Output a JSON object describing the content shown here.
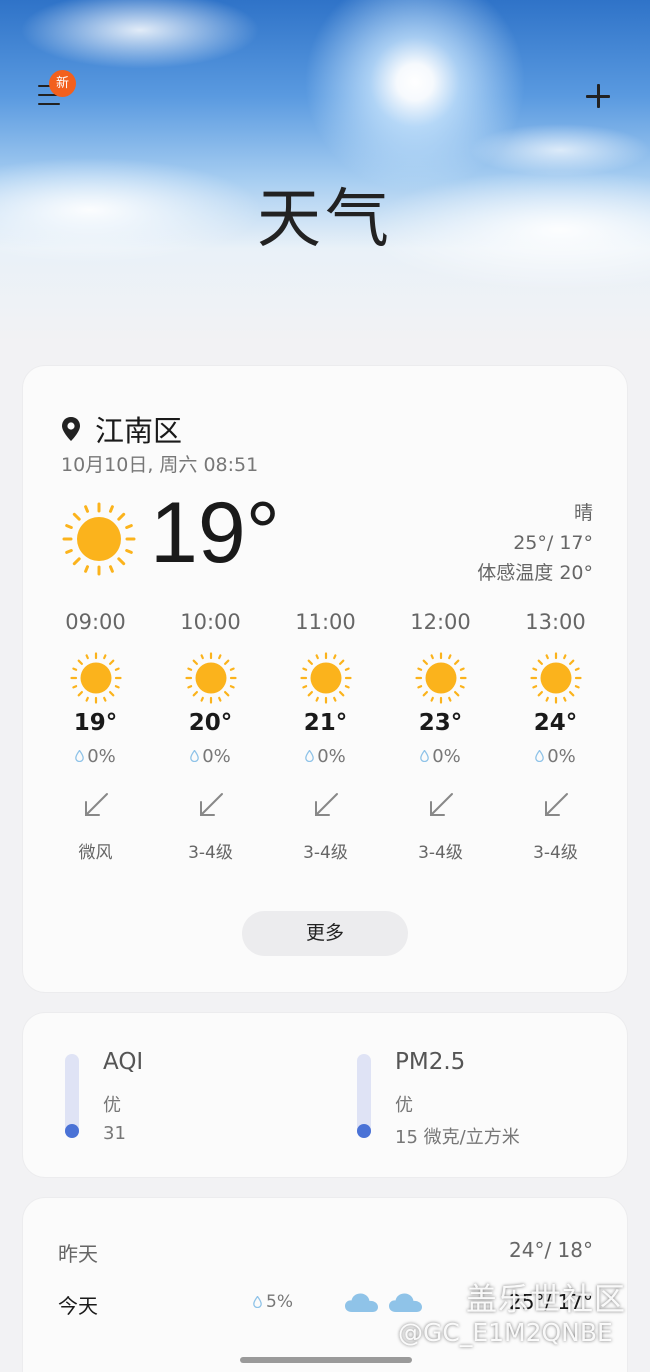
{
  "header": {
    "title": "天气",
    "badge": "新",
    "menu_icon": "menu-icon",
    "add_icon": "plus-icon"
  },
  "current": {
    "location": "江南区",
    "datetime": "10月10日, 周六 08:51",
    "temp": "19°",
    "condition": "晴",
    "high_low": "25°/ 17°",
    "feels_like": "体感温度 20°",
    "icon": "sun-icon"
  },
  "hourly": [
    {
      "time": "09:00",
      "temp": "19°",
      "rain": "0%",
      "wind": "微风"
    },
    {
      "time": "10:00",
      "temp": "20°",
      "rain": "0%",
      "wind": "3-4级"
    },
    {
      "time": "11:00",
      "temp": "21°",
      "rain": "0%",
      "wind": "3-4级"
    },
    {
      "time": "12:00",
      "temp": "23°",
      "rain": "0%",
      "wind": "3-4级"
    },
    {
      "time": "13:00",
      "temp": "24°",
      "rain": "0%",
      "wind": "3-4级"
    }
  ],
  "more_label": "更多",
  "air": {
    "aqi": {
      "label": "AQI",
      "level": "优",
      "value": "31"
    },
    "pm25": {
      "label": "PM2.5",
      "level": "优",
      "value": "15 微克/立方米"
    }
  },
  "daily": [
    {
      "name": "昨天",
      "rain": "",
      "range": "24°/ 18°"
    },
    {
      "name": "今天",
      "rain": "5%",
      "range": "25°/ 17°"
    }
  ],
  "watermark": {
    "line1": "盖乐世社区",
    "line2": "@GC_E1M2QNBE"
  },
  "colors": {
    "accent_badge": "#f2601e",
    "sun": "#fbb31c",
    "gauge": "#4a72d6",
    "drop": "#8fc3e8"
  }
}
